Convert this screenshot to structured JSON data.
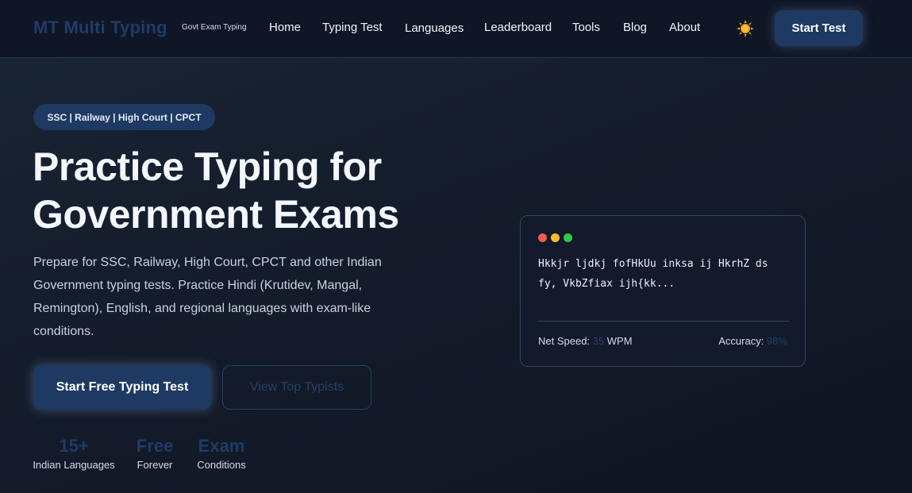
{
  "brand": {
    "logo": "MT Multi Typing",
    "tagline": "Govt Exam Typing"
  },
  "nav": {
    "links": [
      "Home",
      "Typing Test",
      "Languages",
      "Leaderboard",
      "Tools",
      "Blog",
      "About"
    ],
    "theme_icon": "sun-icon",
    "cta": "Start Test"
  },
  "hero": {
    "badge": "SSC | Railway | High Court | CPCT",
    "title_line1": "Practice Typing for",
    "title_line2": "Government Exams",
    "description": "Prepare for SSC, Railway, High Court, CPCT and other Indian Government typing tests. Practice Hindi (Krutidev, Mangal, Remington), English, and regional languages with exam-like conditions.",
    "primary_button": "Start Free Typing Test",
    "secondary_button": "View Top Typists",
    "stats": [
      {
        "value": "15+",
        "label": "Indian Languages"
      },
      {
        "value": "Free",
        "label": "Forever"
      },
      {
        "value": "Exam",
        "label": "Conditions"
      }
    ]
  },
  "preview": {
    "text": "Hkkjr ljdkj fofHkUu inksa ij HkrhZ ds fy, VkbZfiax ijh{kk...",
    "speed_label": "Net Speed:",
    "speed_value": "35",
    "speed_unit": "WPM",
    "accuracy_label": "Accuracy:",
    "accuracy_value": "98%"
  },
  "colors": {
    "accent": "#1e3a63",
    "background": "#141c2b",
    "dot_red": "#f25a52",
    "dot_yellow": "#f5be2f",
    "dot_green": "#2ec84a"
  }
}
